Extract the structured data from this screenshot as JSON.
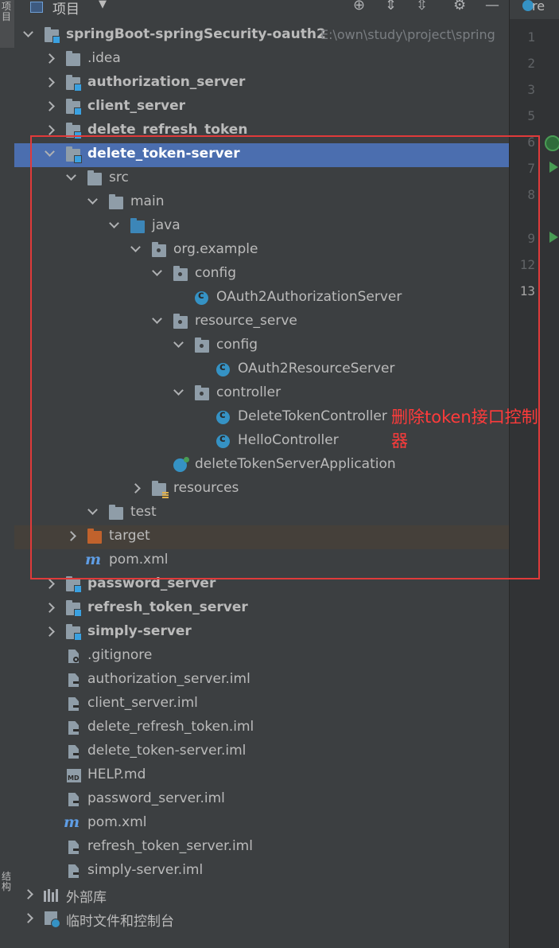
{
  "header": {
    "title": "项目",
    "caret": "▼",
    "icons": [
      "locate-icon",
      "expand-all-icon",
      "collapse-all-icon",
      "gear-icon",
      "hide-icon"
    ]
  },
  "left_strip": {
    "top_label": "项目",
    "bottom_label": "结构"
  },
  "editor_tab": {
    "label": "re"
  },
  "gutter_lines": [
    "1",
    "2",
    "3",
    "5",
    "6",
    "7",
    "8",
    "9",
    "12",
    "13"
  ],
  "tree": [
    {
      "label": "springBoot-springSecurity-oauth2",
      "path": "E:\\own\\study\\project\\spring"
    },
    {
      "label": ".idea"
    },
    {
      "label": "authorization_server"
    },
    {
      "label": "client_server"
    },
    {
      "label": "delete_refresh_token"
    },
    {
      "label": "delete_token-server"
    },
    {
      "label": "src"
    },
    {
      "label": "main"
    },
    {
      "label": "java"
    },
    {
      "label": "org.example"
    },
    {
      "label": "config"
    },
    {
      "label": "OAuth2AuthorizationServer"
    },
    {
      "label": "resource_serve"
    },
    {
      "label": "config"
    },
    {
      "label": "OAuth2ResourceServer"
    },
    {
      "label": "controller"
    },
    {
      "label": "DeleteTokenController"
    },
    {
      "label": "HelloController"
    },
    {
      "label": "deleteTokenServerApplication"
    },
    {
      "label": "resources"
    },
    {
      "label": "test"
    },
    {
      "label": "target"
    },
    {
      "label": "pom.xml"
    },
    {
      "label": "password_server"
    },
    {
      "label": "refresh_token_server"
    },
    {
      "label": "simply-server"
    },
    {
      "label": ".gitignore"
    },
    {
      "label": "authorization_server.iml"
    },
    {
      "label": "client_server.iml"
    },
    {
      "label": "delete_refresh_token.iml"
    },
    {
      "label": "delete_token-server.iml"
    },
    {
      "label": "HELP.md"
    },
    {
      "label": "password_server.iml"
    },
    {
      "label": "pom.xml"
    },
    {
      "label": "refresh_token_server.iml"
    },
    {
      "label": "simply-server.iml"
    },
    {
      "label": "外部库"
    },
    {
      "label": "临时文件和控制台"
    }
  ],
  "annotation": {
    "text": "删除token接口控制器"
  },
  "colors": {
    "selection": "#4b6eaf",
    "annotation": "#e03a3a",
    "background": "#3c3f41"
  }
}
